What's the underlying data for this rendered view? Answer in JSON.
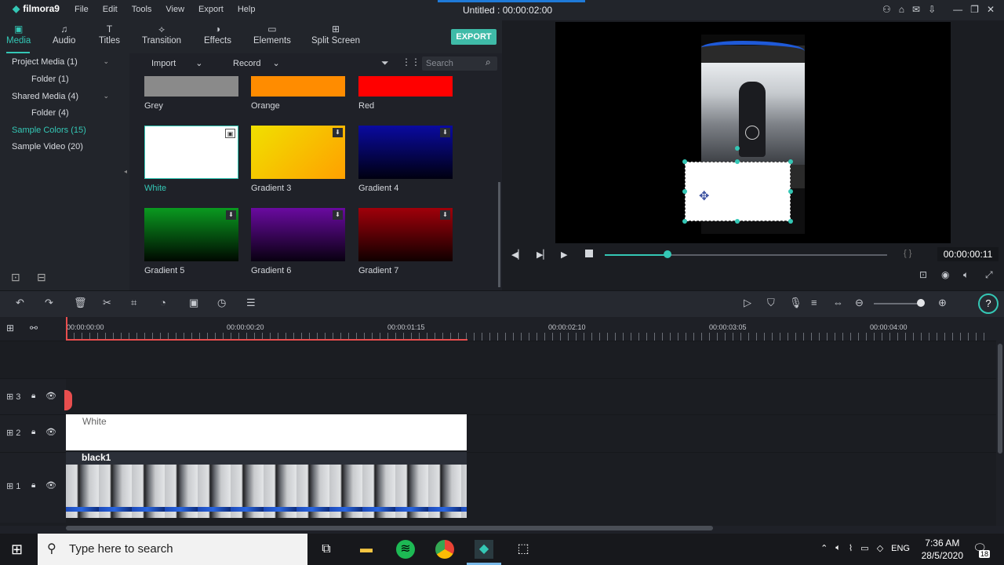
{
  "app": {
    "name": "filmora9",
    "window_title": "Untitled : 00:00:02:00"
  },
  "menu": [
    "File",
    "Edit",
    "Tools",
    "View",
    "Export",
    "Help"
  ],
  "tabs": [
    {
      "label": "Media",
      "icon": "folder-icon"
    },
    {
      "label": "Audio",
      "icon": "music-note-icon"
    },
    {
      "label": "Titles",
      "icon": "text-icon"
    },
    {
      "label": "Transition",
      "icon": "transition-icon"
    },
    {
      "label": "Effects",
      "icon": "effects-icon"
    },
    {
      "label": "Elements",
      "icon": "image-icon"
    },
    {
      "label": "Split Screen",
      "icon": "split-screen-icon"
    }
  ],
  "export_label": "EXPORT",
  "sidebar": [
    {
      "label": "Project Media (1)",
      "caret": true
    },
    {
      "label": "Folder (1)"
    },
    {
      "label": "Shared Media (4)",
      "caret": true
    },
    {
      "label": "Folder (4)"
    },
    {
      "label": "Sample Colors (15)",
      "active": true
    },
    {
      "label": "Sample Video (20)"
    }
  ],
  "media_toolbar": {
    "import": "Import",
    "record": "Record",
    "search_placeholder": "Search"
  },
  "media_items": [
    {
      "label": "Grey",
      "color": "#8a8a8a"
    },
    {
      "label": "Orange",
      "color": "#ff8c00"
    },
    {
      "label": "Red",
      "color": "#ff0000"
    },
    {
      "label": "White",
      "color": "#ffffff",
      "active": true
    },
    {
      "label": "Gradient 3",
      "color": "linear-gradient(135deg,#f0e000,#ffa000)"
    },
    {
      "label": "Gradient 4",
      "color": "linear-gradient(180deg,#0a0aa0,#000010)"
    },
    {
      "label": "Gradient 5",
      "color": "linear-gradient(180deg,#0a9a20,#000800)"
    },
    {
      "label": "Gradient 6",
      "color": "linear-gradient(180deg,#6a0aa0,#080010)"
    },
    {
      "label": "Gradient 7",
      "color": "linear-gradient(180deg,#a0000a,#100000)"
    }
  ],
  "player": {
    "timecode": "00:00:00:11",
    "progress": 0.22
  },
  "timeline": {
    "ruler_labels": [
      "00:00:00:00",
      "00:00:00:20",
      "00:00:01:15",
      "00:00:02:10",
      "00:00:03:05",
      "00:00:04:00"
    ],
    "tracks": [
      {
        "num": "3"
      },
      {
        "num": "2",
        "clip": "White"
      },
      {
        "num": "1",
        "clip": "black1"
      }
    ]
  },
  "taskbar": {
    "search": "Type here to search",
    "language": "ENG",
    "time": "7:36 AM",
    "date": "28/5/2020",
    "notifications": "18"
  }
}
